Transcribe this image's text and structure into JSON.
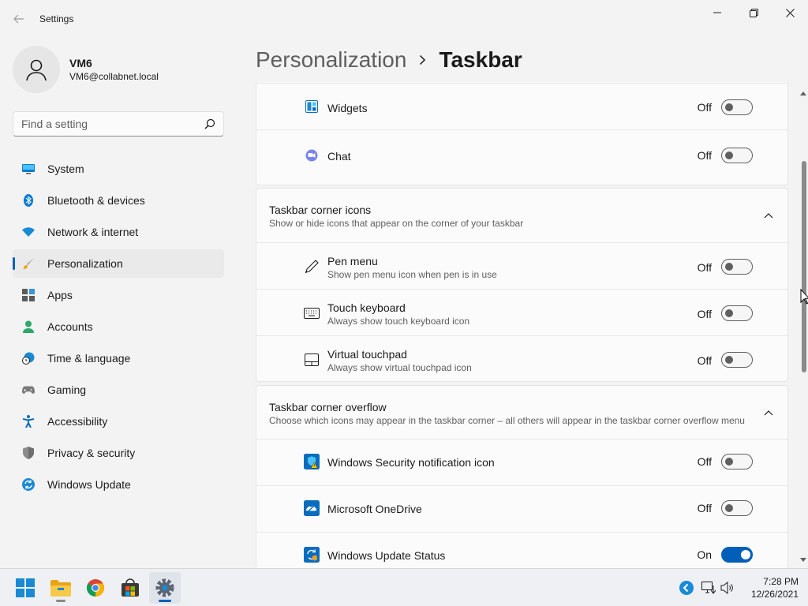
{
  "window": {
    "title": "Settings",
    "controls": {
      "minimize": "minimize",
      "maximize": "maximize",
      "close": "close"
    }
  },
  "profile": {
    "name": "VM6",
    "email": "VM6@collabnet.local"
  },
  "search": {
    "placeholder": "Find a setting"
  },
  "sidebar": {
    "items": [
      {
        "label": "System",
        "icon": "monitor-icon"
      },
      {
        "label": "Bluetooth & devices",
        "icon": "bluetooth-icon"
      },
      {
        "label": "Network & internet",
        "icon": "wifi-icon"
      },
      {
        "label": "Personalization",
        "icon": "paintbrush-icon",
        "active": true
      },
      {
        "label": "Apps",
        "icon": "apps-icon"
      },
      {
        "label": "Accounts",
        "icon": "person-icon"
      },
      {
        "label": "Time & language",
        "icon": "clock-globe-icon"
      },
      {
        "label": "Gaming",
        "icon": "gamepad-icon"
      },
      {
        "label": "Accessibility",
        "icon": "accessibility-icon"
      },
      {
        "label": "Privacy & security",
        "icon": "shield-icon"
      },
      {
        "label": "Windows Update",
        "icon": "update-icon"
      }
    ]
  },
  "header": {
    "parent": "Personalization",
    "current": "Taskbar"
  },
  "taskbar_items": {
    "rows": [
      {
        "label": "Widgets",
        "state": "Off",
        "on": false
      },
      {
        "label": "Chat",
        "state": "Off",
        "on": false
      }
    ]
  },
  "corner_icons": {
    "title": "Taskbar corner icons",
    "subtitle": "Show or hide icons that appear on the corner of your taskbar",
    "rows": [
      {
        "label": "Pen menu",
        "sub": "Show pen menu icon when pen is in use",
        "state": "Off",
        "on": false
      },
      {
        "label": "Touch keyboard",
        "sub": "Always show touch keyboard icon",
        "state": "Off",
        "on": false
      },
      {
        "label": "Virtual touchpad",
        "sub": "Always show virtual touchpad icon",
        "state": "Off",
        "on": false
      }
    ]
  },
  "corner_overflow": {
    "title": "Taskbar corner overflow",
    "subtitle": "Choose which icons may appear in the taskbar corner – all others will appear in the taskbar corner overflow menu",
    "rows": [
      {
        "label": "Windows Security notification icon",
        "state": "Off",
        "on": false
      },
      {
        "label": "Microsoft OneDrive",
        "state": "Off",
        "on": false
      },
      {
        "label": "Windows Update Status",
        "state": "On",
        "on": true
      }
    ]
  },
  "colors": {
    "accent": "#005fb8",
    "background": "#f3f3f3",
    "card": "#fbfbfb"
  },
  "taskbar": {
    "apps": [
      "start-icon",
      "file-explorer-icon",
      "chrome-icon",
      "store-icon",
      "settings-icon"
    ],
    "active_app": "settings-icon",
    "tray": [
      "update-tray-icon",
      "network-icon",
      "volume-icon"
    ],
    "time": "7:28 PM",
    "date": "12/26/2021"
  }
}
